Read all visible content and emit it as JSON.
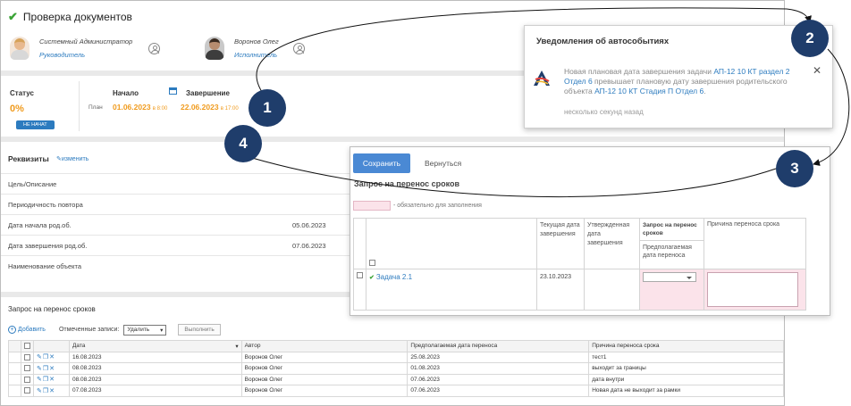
{
  "header": {
    "title": "Проверка документов"
  },
  "people": [
    {
      "name": "Системный Администратор",
      "role": "Руководитель"
    },
    {
      "name": "Воронов Олег",
      "role": "Исполнитель"
    }
  ],
  "status": {
    "label": "Статус",
    "percent": "0%",
    "badge": "НЕ НАЧАТ",
    "start_label": "Начало",
    "end_label": "Завершение",
    "plan_label": "План",
    "start_date": "01.06.2023",
    "start_time": "в 8:00",
    "end_date": "22.06.2023",
    "end_time": "в 17:00"
  },
  "requisites": {
    "title": "Реквизиты",
    "edit": "изменить",
    "rows": [
      {
        "label": "Цель/Описание",
        "value": ""
      },
      {
        "label": "Периодичность повтора",
        "value": ""
      },
      {
        "label": "Дата начала род.об.",
        "value": "05.06.2023"
      },
      {
        "label": "Дата завершения род.об.",
        "value": "07.06.2023"
      },
      {
        "label": "Наименование объекта",
        "value": ""
      }
    ]
  },
  "requests": {
    "title": "Запрос на перенос сроков",
    "add": "Добавить",
    "marked_label": "Отмеченные записи:",
    "action_value": "Удалить",
    "run": "Выполнить",
    "columns": [
      "Дата",
      "Автор",
      "Предполагаемая дата переноса",
      "Причина переноса срока"
    ],
    "rows": [
      [
        "16.08.2023",
        "Воронов Олег",
        "25.08.2023",
        "тест1"
      ],
      [
        "08.08.2023",
        "Воронов Олег",
        "01.08.2023",
        "выходит за границы"
      ],
      [
        "08.08.2023",
        "Воронов Олег",
        "07.06.2023",
        "дата внутри"
      ],
      [
        "07.08.2023",
        "Воронов Олег",
        "07.06.2023",
        "Новая дата не выходит за рамки"
      ]
    ]
  },
  "notification": {
    "title": "Уведомления об автособытиях",
    "text_1": "Новая плановая дата завершения задачи ",
    "link_1": "АП-12 10 КТ раздел 2 Отдел 6",
    "text_2": " превышает плановую дату завершения родительского объекта ",
    "link_2": "АП-12 10 КТ Стадия П Отдел 6",
    "text_3": ".",
    "time": "несколько секунд назад",
    "close": "✕"
  },
  "dialog": {
    "save": "Сохранить",
    "back": "Вернуться",
    "title": "Запрос на перенос сроков",
    "legend": "- обязательно для заполнения",
    "col_current": "Текущая дата завершения",
    "col_approved": "Утвержденная дата завершения",
    "col_request": "Запрос на перенос сроков",
    "col_request_sub": "Предполагаемая дата переноса",
    "col_reason": "Причина переноса срока",
    "task_name": "Задача 2.1",
    "task_current": "23.10.2023",
    "task_approved": ""
  },
  "markers": [
    "1",
    "2",
    "3",
    "4"
  ],
  "colors": {
    "accent": "#2c7bbf",
    "orange": "#f09b1e",
    "marker": "#1f3d6b",
    "required": "#fbe3ea"
  }
}
